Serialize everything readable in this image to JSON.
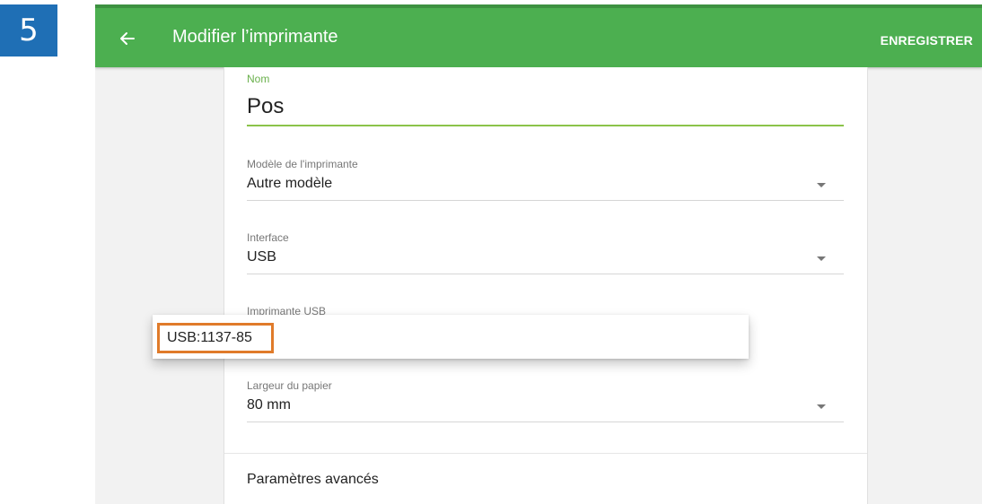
{
  "step": {
    "number": "5"
  },
  "appbar": {
    "title": "Modifier l’imprimante",
    "save_label": "ENREGISTRER",
    "back_icon": "arrow-left-icon",
    "color": "#4caf50"
  },
  "form": {
    "name": {
      "label": "Nom",
      "value": "Pos"
    },
    "model": {
      "label": "Modèle de l'imprimante",
      "value": "Autre modèle"
    },
    "interface": {
      "label": "Interface",
      "value": "USB"
    },
    "usb_printer": {
      "label": "Imprimante USB",
      "options": [
        "USB:1137-85"
      ]
    },
    "paper_width": {
      "label": "Largeur du papier",
      "value": "80 mm"
    },
    "advanced_label": "Paramètres avancés"
  },
  "colors": {
    "step_badge": "#1f6fb5",
    "highlight": "#e07b2a",
    "accent": "#8bc34a"
  }
}
